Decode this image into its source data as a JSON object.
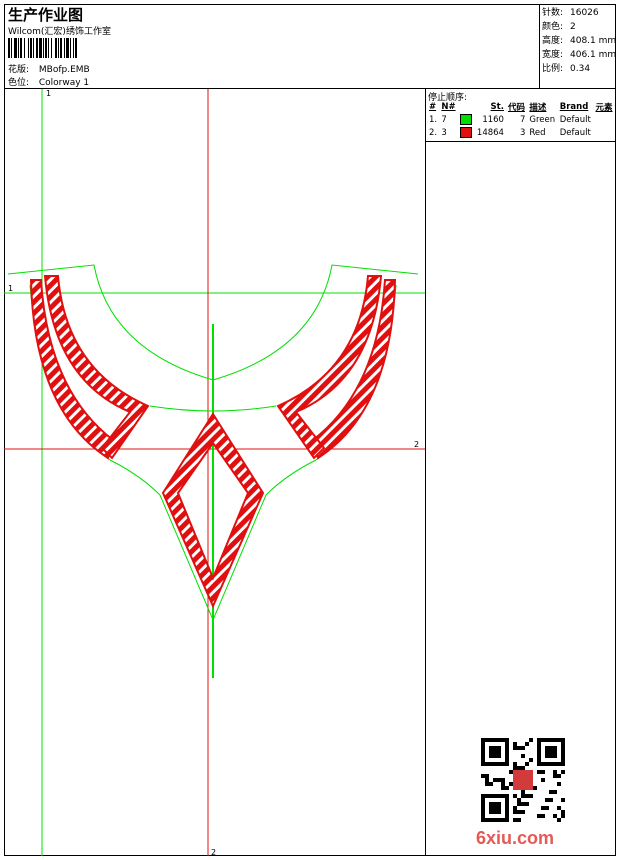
{
  "header": {
    "title": "生产作业图",
    "company": "Wilcom(汇宏)绣饰工作室",
    "design_label": "花版:",
    "design_value": "MBofp.EMB",
    "color_label": "色位:",
    "color_value": "Colorway 1"
  },
  "stats": [
    {
      "label": "针数:",
      "value": "16026"
    },
    {
      "label": "颜色:",
      "value": "2"
    },
    {
      "label": "高度:",
      "value": "408.1 mm"
    },
    {
      "label": "宽度:",
      "value": "406.1 mm"
    },
    {
      "label": "比例:",
      "value": "0.34"
    }
  ],
  "sequence": {
    "title": "停止顺序:",
    "columns": [
      "#",
      "N#",
      "St.",
      "代码",
      "描述",
      "Brand",
      "元素"
    ],
    "rows": [
      {
        "index": "1.",
        "n": "7",
        "color": "#00e000",
        "stitches": "1160",
        "code": "7",
        "desc": "Green",
        "brand": "Default"
      },
      {
        "index": "2.",
        "n": "3",
        "color": "#e01010",
        "stitches": "14864",
        "code": "3",
        "desc": "Red",
        "brand": "Default"
      }
    ]
  },
  "guides": {
    "h_left": "1",
    "v_top": "1",
    "h_right": "2",
    "v_bottom": "2"
  },
  "watermark": "6xiu.com",
  "colors": {
    "green": "#00e000",
    "red": "#e01010",
    "frame": "#000000"
  }
}
